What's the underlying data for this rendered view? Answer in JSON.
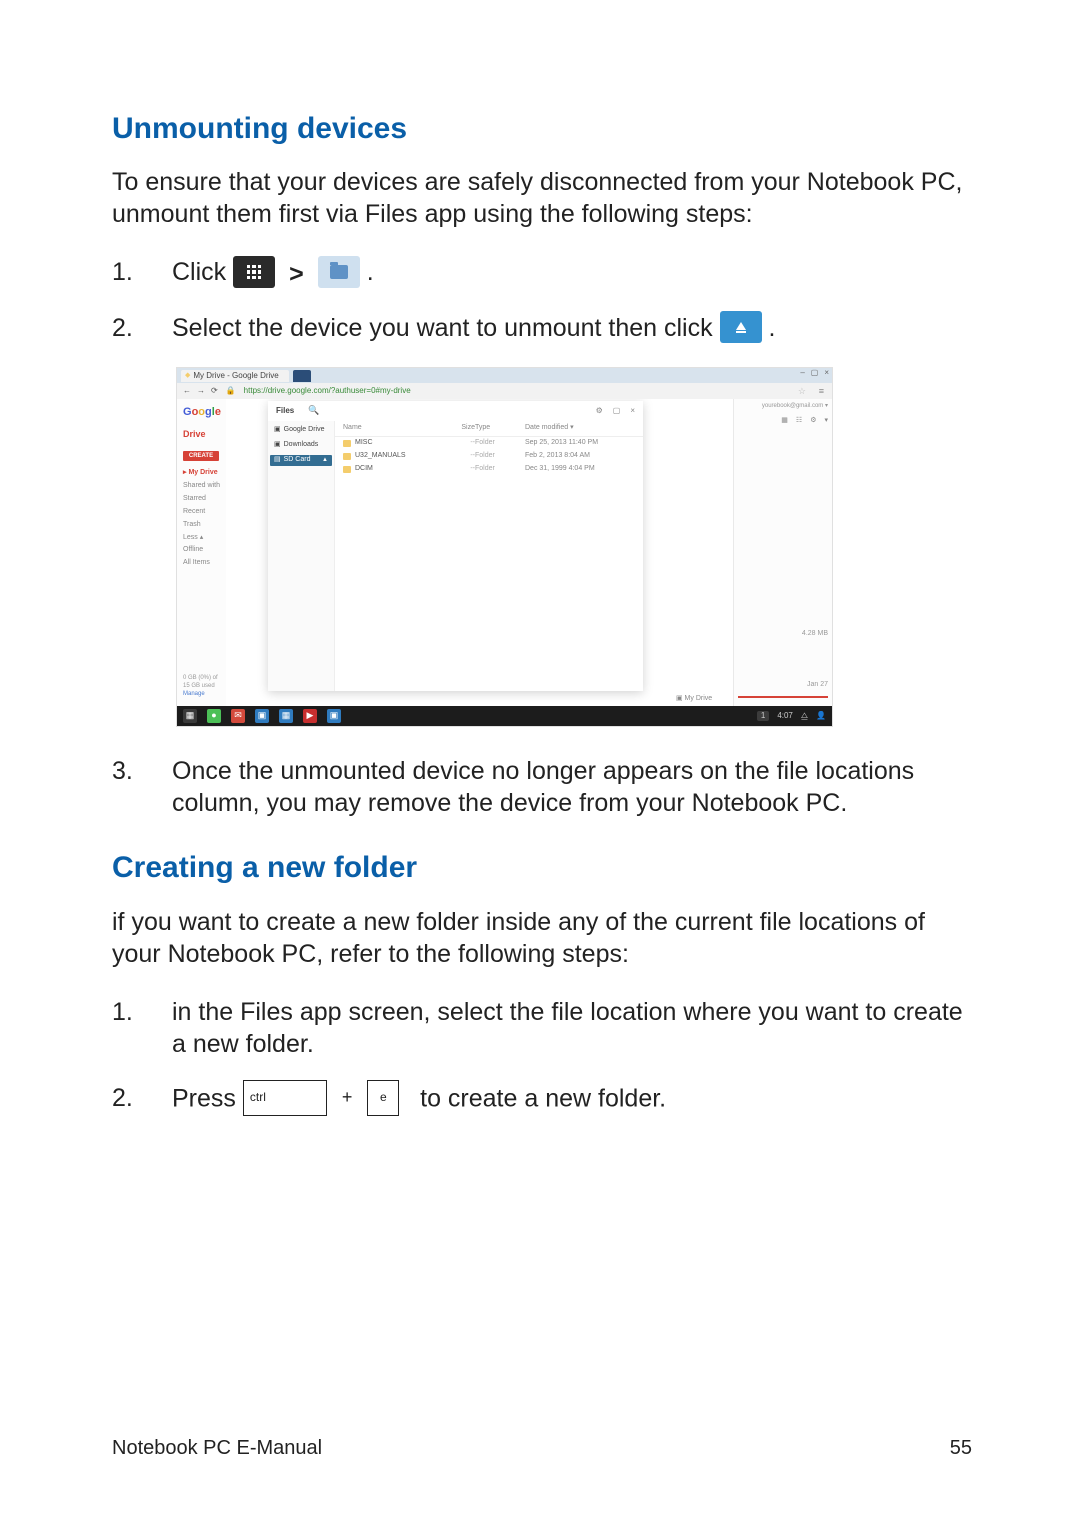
{
  "sections": {
    "unmount_title": "Unmounting devices",
    "unmount_para": "To ensure that your devices are safely disconnected from your Notebook PC, unmount them first via Files app using the following steps:",
    "step1_prefix": "Click",
    "step1_gt": ">",
    "step1_suffix": ".",
    "step2_a": "Select the device you want to unmount then click",
    "step2_b": ".",
    "step3": "Once the unmounted device no longer appears on the file locations column, you may remove the device from your Notebook PC.",
    "create_title": "Creating a new folder",
    "create_para": "if you want to create a new folder inside any of the current file locations of your Notebook PC, refer to the following steps:",
    "cstep1": "in the Files app screen, select the file location where you want to create a new folder.",
    "cstep2_a": "Press",
    "cstep2_b": "to create a new folder.",
    "num1": "1.",
    "num2": "2.",
    "num3": "3."
  },
  "keys": {
    "ctrl": "ctrl",
    "plus": "+",
    "e": "e"
  },
  "footer": {
    "left": "Notebook PC E-Manual",
    "right": "55"
  },
  "screenshot": {
    "tab_title": "My Drive - Google Drive",
    "window_min": "–",
    "window_max": "▢",
    "window_close": "×",
    "url": "drive.google.com/?authuser=0#my-drive",
    "nav_back": "←",
    "nav_fwd": "→",
    "nav_reload": "⟳",
    "lock": "🔒",
    "star": "☆",
    "menu": "≡",
    "google": {
      "g1": "G",
      "o1": "o",
      "o2": "o",
      "g2": "g",
      "l": "l",
      "e": "e"
    },
    "drive_word": "Drive",
    "create_btn": "CREATE",
    "left_nav": {
      "mydrive": "▸ My Drive",
      "shared": "Shared with",
      "starred": "Starred",
      "recent": "Recent",
      "trash": "Trash",
      "less": "Less ▴",
      "offline": "Offline",
      "allitems": "All Items"
    },
    "storage": "0 GB (0%) of 15 GB used",
    "manage": "Manage",
    "files_title": "Files",
    "files_search_icon": "🔍",
    "files_gear": "⚙",
    "files_max": "▢",
    "files_close": "×",
    "files_side": {
      "gdrive": "Google Drive",
      "downloads": "Downloads",
      "sdcard": "SD Card"
    },
    "thead": {
      "name": "Name",
      "size": "Size",
      "type": "Type",
      "date": "Date modified ▾"
    },
    "rows": [
      {
        "name": "MISC",
        "size": "--",
        "type": "Folder",
        "date": "Sep 25, 2013 11:40 PM"
      },
      {
        "name": "U32_MANUALS",
        "size": "--",
        "type": "Folder",
        "date": "Feb 2, 2013 8:04 AM"
      },
      {
        "name": "DCIM",
        "size": "--",
        "type": "Folder",
        "date": "Dec 31, 1999 4:04 PM"
      }
    ],
    "account": "yourebook@gmail.com ▾",
    "r_list": "▦",
    "r_grid": "☷",
    "r_gear": "⚙",
    "r_down": "▾",
    "r_size": "4.28 MB",
    "r_date": "Jan 27",
    "breadcrumb": "▣ My Drive",
    "shelf": {
      "launcher": "▦",
      "tray_notify": "1",
      "tray_time": "4:07",
      "tray_wifi": "⧋",
      "tray_user": "👤"
    }
  }
}
